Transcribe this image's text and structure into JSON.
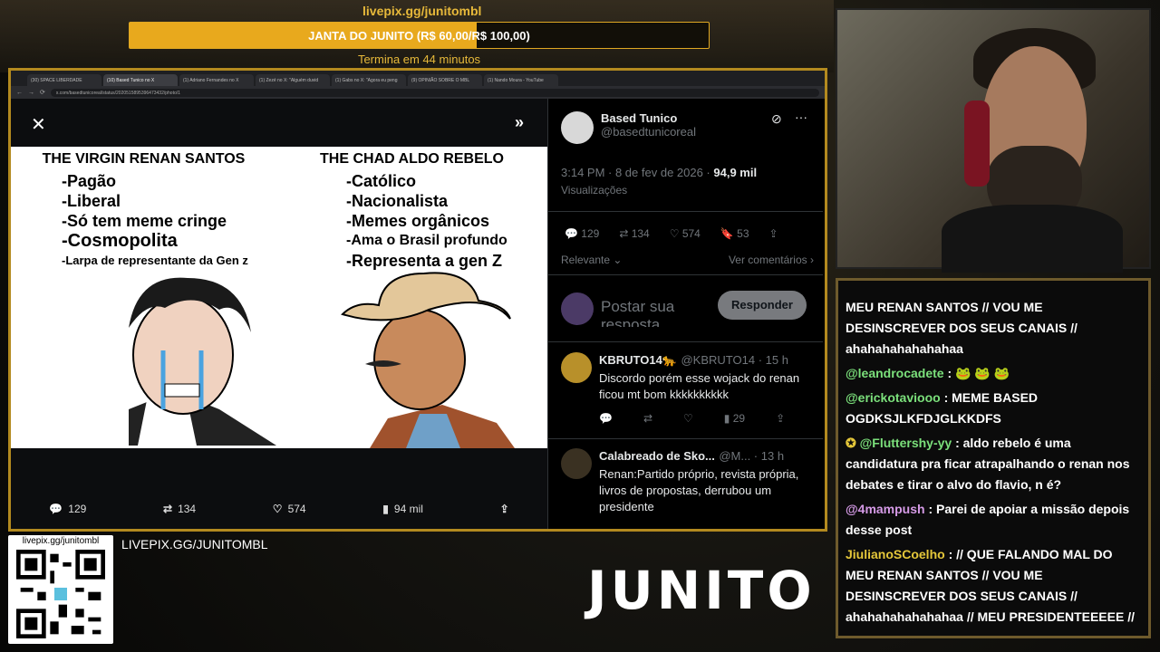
{
  "goal": {
    "url": "livepix.gg/junitombl",
    "label": "JANTA DO JUNITO (R$ 60,00/R$ 100,00)",
    "progress": 0.6,
    "time_left": "Termina em 44 minutos"
  },
  "browser": {
    "tabs": [
      "(30) SPACE LIBERDADE",
      "(10) Based Tunico no X",
      "(1) Adriano Fernandes no X",
      "(1) Zezé no X: \"Alguém duvid",
      "(1) Gabs no X: \"Agora eu peng",
      "(9) OPINIÃO SOBRE O MBL",
      "(1) Nando Moura - YouTube"
    ],
    "url": "x.com/basedtunicoreal/status/2020515895396473432/photo/1"
  },
  "meme": {
    "left": {
      "title": "THE VIRGIN RENAN SANTOS",
      "items": [
        "-Pagão",
        "-Liberal",
        "-Só tem meme cringe",
        "-Cosmopolita",
        "-Larpa de representante da Gen z"
      ]
    },
    "right": {
      "title": "THE CHAD ALDO REBELO",
      "items": [
        "-Católico",
        "-Nacionalista",
        "-Memes orgânicos",
        "-Ama o Brasil profundo",
        "-Representa a gen Z"
      ]
    }
  },
  "viewer_stats": {
    "replies": "129",
    "reposts": "134",
    "likes": "574",
    "views": "94 mil"
  },
  "tweet": {
    "name": "Based Tunico",
    "handle": "@basedtunicoreal",
    "timestamp": "3:14 PM · 8 de fev de 2026 · ",
    "views_count": "94,9 mil",
    "views_label": "Visualizações",
    "replies": "129",
    "reposts": "134",
    "likes": "574",
    "bookmarks": "53",
    "sort": "Relevante",
    "see_comments": "Ver comentários",
    "reply_placeholder": "Postar sua resposta",
    "reply_button": "Responder"
  },
  "replies": [
    {
      "name": "KBRUTO14🐆",
      "handle": "@KBRUTO14 · 15 h",
      "text": "Discordo porém esse wojack do renan ficou mt bom kkkkkkkkkk",
      "views": "29"
    },
    {
      "name": "Calabreado de Sko...",
      "handle": "@M... · 13 h",
      "text": "Renan:Partido próprio, revista própria, livros de propostas, derrubou um presidente"
    }
  ],
  "chat": [
    {
      "user": "",
      "text": "MEU RENAN SANTOS // VOU ME DESINSCREVER DOS SEUS CANAIS // ahahahahahahahaa"
    },
    {
      "user": "@leandrocadete",
      "text": " : 🐸 🐸 🐸"
    },
    {
      "user": "@erickotaviooo",
      "text": " : MEME BASED OGDKSJLKFDJGLKKDFS"
    },
    {
      "user": "@Fluttershy-yy",
      "text": " : aldo rebelo é uma candidatura pra ficar atrapalhando o renan nos debates e tirar o alvo do flavio, n é?"
    },
    {
      "user": "@4mampush",
      "text": " : Parei de apoiar a missão depois desse post"
    },
    {
      "user": "JiulianoSCoelho",
      "text": " : // QUE FALANDO MAL DO MEU RENAN SANTOS // VOU ME DESINSCREVER DOS SEUS CANAIS // ahahahahahahahaa // MEU PRESIDENTEEEEE //"
    }
  ],
  "qr_url": "livepix.gg/junitombl",
  "livepix_text": "LIVEPIX.GG/JUNITOMBL",
  "logo": "JUNITO",
  "colors": {
    "accent": "#e8a91d",
    "chat_green": "#7be07b"
  }
}
